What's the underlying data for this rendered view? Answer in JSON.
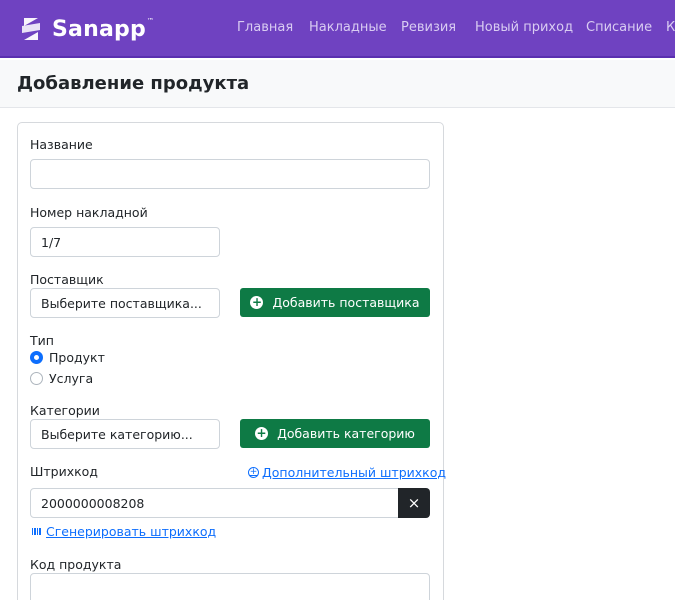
{
  "navbar": {
    "logo_text": "Sanapp",
    "logo_tm": "™",
    "items": [
      "Главная",
      "Накладные",
      "Ревизия",
      "Новый приход",
      "Списание",
      "К"
    ]
  },
  "page": {
    "title": "Добавление продукта"
  },
  "form": {
    "name": {
      "label": "Название",
      "value": ""
    },
    "invoice": {
      "label": "Номер накладной",
      "value": "1/7"
    },
    "supplier": {
      "label": "Поставщик",
      "placeholder": "Выберите поставщика...",
      "add_button": "Добавить поставщика"
    },
    "type": {
      "label": "Тип",
      "options": [
        "Продукт",
        "Услуга"
      ],
      "selected": "Продукт"
    },
    "categories": {
      "label": "Категории",
      "placeholder": "Выберите категорию...",
      "add_button": "Добавить категорию"
    },
    "barcode": {
      "label": "Штрихкод",
      "extra_link": "Дополнительный штрихкод",
      "value": "2000000008208",
      "clear_icon": "×",
      "generate_link": "Сгенерировать штрихкод"
    },
    "product_code": {
      "label": "Код продукта",
      "value": ""
    }
  },
  "colors": {
    "navbar": "#6f42c1",
    "success": "#0e7a45",
    "primary": "#0d6efd",
    "dark": "#212529"
  }
}
